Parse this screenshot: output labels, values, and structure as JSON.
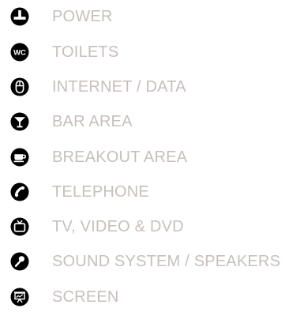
{
  "legend": {
    "items": [
      {
        "label": "POWER",
        "icon": "power-plug-icon"
      },
      {
        "label": "TOILETS",
        "icon": "wc-icon"
      },
      {
        "label": "INTERNET / DATA",
        "icon": "mouse-icon"
      },
      {
        "label": "BAR AREA",
        "icon": "cocktail-glass-icon"
      },
      {
        "label": "BREAKOUT AREA",
        "icon": "coffee-cup-icon"
      },
      {
        "label": "TELEPHONE",
        "icon": "telephone-icon"
      },
      {
        "label": "TV, VIDEO & DVD",
        "icon": "tv-icon"
      },
      {
        "label": "SOUND SYSTEM / SPEAKERS",
        "icon": "microphone-icon"
      },
      {
        "label": "SCREEN",
        "icon": "projector-screen-icon"
      }
    ],
    "icon_badge_text": "WC"
  },
  "colors": {
    "icon": "#000000",
    "label": "#c8bfbc",
    "background": "#ffffff"
  }
}
